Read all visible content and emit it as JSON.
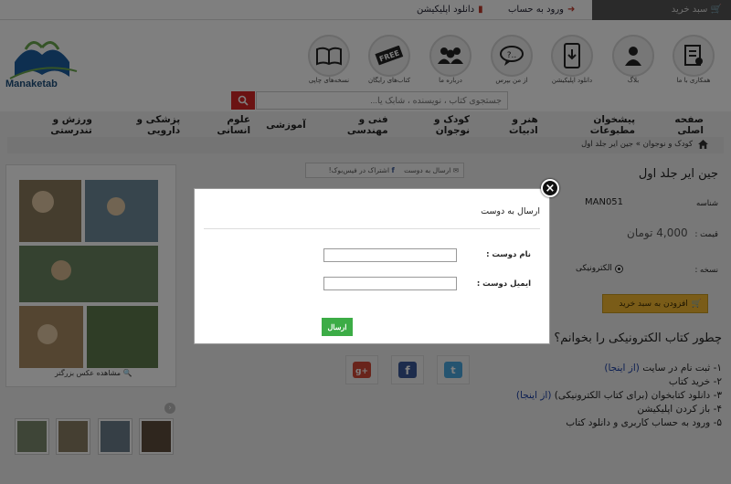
{
  "topbar": {
    "cart_label": "سبد خرید",
    "login_label": "ورود به حساب",
    "download_app_label": "دانلود اپلیکیشن"
  },
  "logo": {
    "text": "Manaketab"
  },
  "header_icons": [
    {
      "label": "همکاری با ما",
      "icon": "cooperation-icon"
    },
    {
      "label": "بلاگ",
      "icon": "blog-icon"
    },
    {
      "label": "دانلود اپلیکیشن",
      "icon": "phone-download-icon"
    },
    {
      "label": "از من بپرس",
      "icon": "question-bubble-icon"
    },
    {
      "label": "درباره ما",
      "icon": "people-icon"
    },
    {
      "label": "کتاب‌های رایگان",
      "icon": "free-tag-icon"
    },
    {
      "label": "نسخه‌های چاپی",
      "icon": "open-book-icon"
    }
  ],
  "search": {
    "placeholder": "جستجوی کتاب ، نویسنده ، شابک یا..."
  },
  "nav": [
    "صفحه اصلی",
    "پیشخوان مطبوعات",
    "هنر و ادبیات",
    "کودک و نوجوان",
    "فنی و مهندسی",
    "آموزشی",
    "علوم انسانی",
    "پزشکی و دارویی",
    "ورزش و تندرستی"
  ],
  "breadcrumb": "کودک و نوجوان  »  جین ایر جلد اول",
  "product": {
    "title": "جین ایر جلد اول",
    "id_label": "شناسه",
    "id_value": "MAN051",
    "price_label": "قیمت :",
    "price_value": "4,000 تومان",
    "version_label": "نسخه :",
    "version_value": "الکترونیکی",
    "add_to_cart": "افزودن به سبد خرید",
    "share_email": "ارسال به دوست",
    "share_facebook": "اشتراک در فیس‌بوک!",
    "zoom_label": "مشاهده عکس بزرگتر"
  },
  "how_to": {
    "title": "چطور کتاب الکترونیکی را بخوانم؟",
    "step1": "۱- ثبت نام در سایت",
    "step1_link": "(از اینجا)",
    "step2": "۲- خرید کتاب",
    "step3": "۳- دانلود کتابخوان (برای کتاب الکترونیکی)",
    "step3_link": "(از اینجا)",
    "step4": "۴- باز کردن اپلیکیشن",
    "step5": "۵- ورود به حساب کاربری و دانلود کتاب"
  },
  "modal": {
    "title": "ارسال به دوست",
    "name_label": "نام دوست :",
    "email_label": "ایمیل دوست :",
    "name_value": "",
    "email_value": "",
    "send_label": "ارسال"
  },
  "colors": {
    "accent_red": "#d62727",
    "cart_yellow": "#f5b930",
    "send_green": "#3cac46"
  }
}
